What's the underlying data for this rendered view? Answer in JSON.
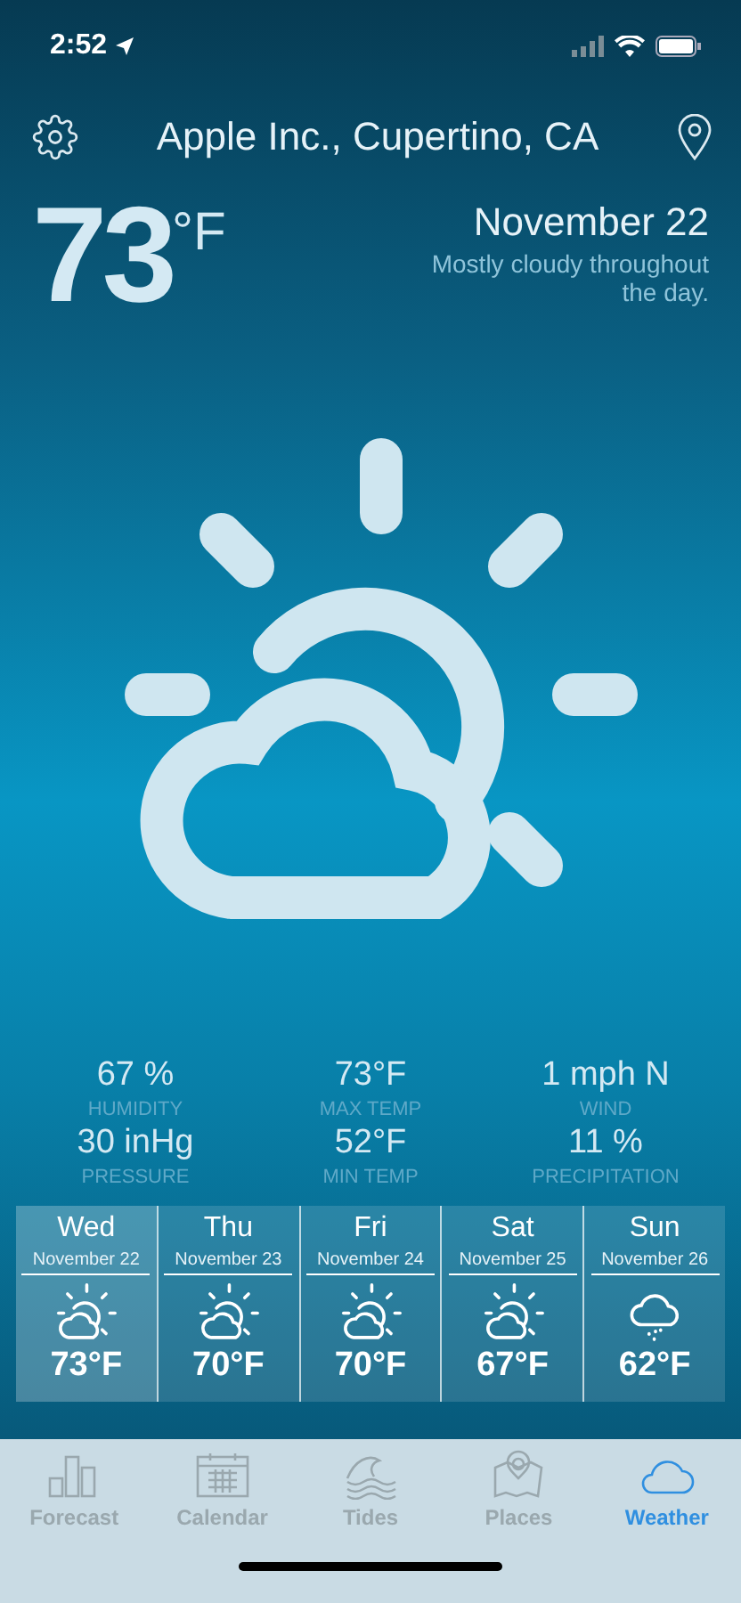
{
  "status_bar": {
    "time": "2:52"
  },
  "header": {
    "location": "Apple Inc., Cupertino, CA"
  },
  "current": {
    "temperature": "73",
    "unit": "°F",
    "date": "November 22",
    "summary": "Mostly cloudy throughout the day.",
    "kind": "partly-sunny"
  },
  "stats": [
    {
      "value": "67 %",
      "label": "HUMIDITY"
    },
    {
      "value": "73°F",
      "label": "MAX TEMP"
    },
    {
      "value": "1 mph N",
      "label": "WIND"
    },
    {
      "value": "30 inHg",
      "label": "PRESSURE"
    },
    {
      "value": "52°F",
      "label": "MIN TEMP"
    },
    {
      "value": "11 %",
      "label": "PRECIPITATION"
    }
  ],
  "forecast": [
    {
      "day": "Wed",
      "date": "November 22",
      "kind": "partly-sunny",
      "temp": "73°F",
      "selected": true
    },
    {
      "day": "Thu",
      "date": "November 23",
      "kind": "partly-sunny",
      "temp": "70°F",
      "selected": false
    },
    {
      "day": "Fri",
      "date": "November 24",
      "kind": "partly-sunny",
      "temp": "70°F",
      "selected": false
    },
    {
      "day": "Sat",
      "date": "November 25",
      "kind": "partly-sunny",
      "temp": "67°F",
      "selected": false
    },
    {
      "day": "Sun",
      "date": "November 26",
      "kind": "rain",
      "temp": "62°F",
      "selected": false
    }
  ],
  "tabs": [
    {
      "label": "Forecast",
      "kind": "chart",
      "selected": false
    },
    {
      "label": "Calendar",
      "kind": "calendar",
      "selected": false
    },
    {
      "label": "Tides",
      "kind": "waves",
      "selected": false
    },
    {
      "label": "Places",
      "kind": "map",
      "selected": false
    },
    {
      "label": "Weather",
      "kind": "cloud",
      "selected": true
    }
  ]
}
